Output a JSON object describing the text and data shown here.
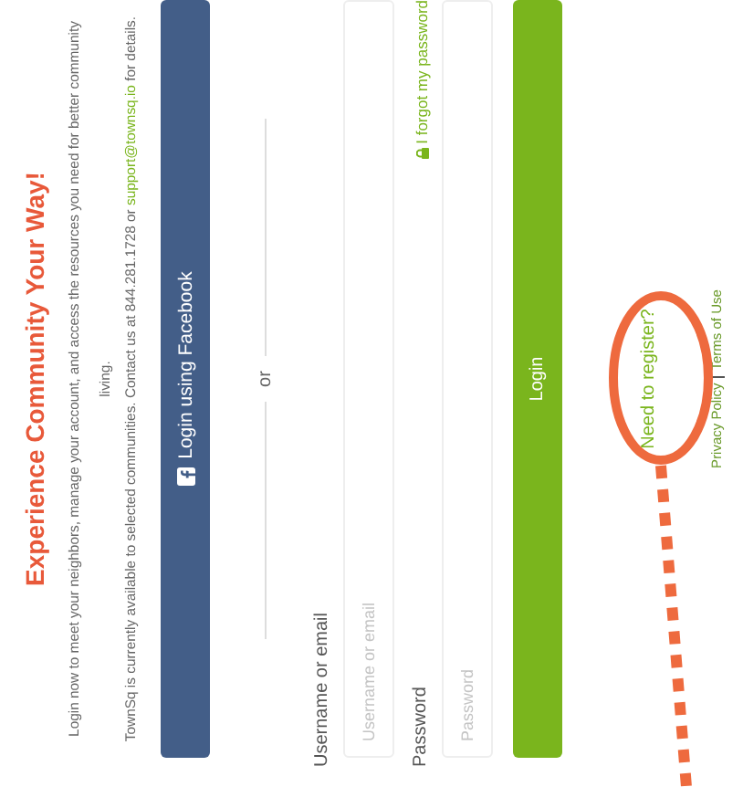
{
  "title": "Experience Community Your Way!",
  "intro": "Login now to meet your neighbors, manage your account, and access the resources you need for better community living.",
  "availability": {
    "before": "TownSq is currently available to selected communities. Contact us at 844.281.1728 or ",
    "link": "support@townsq.io",
    "after": " for details."
  },
  "facebook_button": {
    "label": "Login using Facebook"
  },
  "divider": "or",
  "fields": [
    {
      "label": "Username or email",
      "placeholder": "Username or email"
    },
    {
      "label": "Password",
      "placeholder": "Password",
      "link": "I forgot my password"
    }
  ],
  "login_button": "Login",
  "register_link": "Need to register?",
  "footer_links": [
    "Privacy Policy",
    "Terms of Use"
  ]
}
